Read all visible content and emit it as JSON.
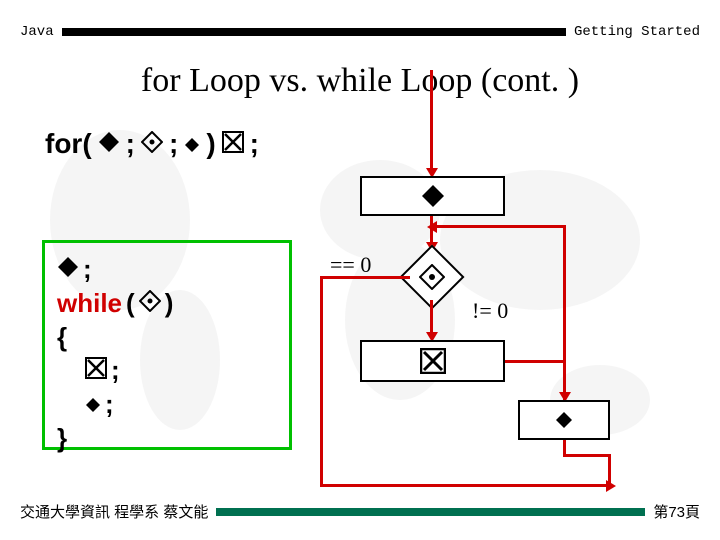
{
  "header": {
    "left": "Java",
    "right": "Getting Started"
  },
  "title": "for Loop vs. while Loop (cont. )",
  "for_line": {
    "kw": "for(",
    "sep1": " ; ",
    "sep2": " ; ",
    "close": ") ",
    "end": ";"
  },
  "while_block": {
    "line1_end": ";",
    "while_kw": "while",
    "while_open": "(",
    "while_close": " )",
    "brace_open": "{",
    "body1_end": " ;",
    "body2_end": ";",
    "brace_close": "}"
  },
  "flow": {
    "eq_label": "== 0",
    "ne_label": "!= 0"
  },
  "symbols": {
    "init": "◆",
    "cond": "❖",
    "update": "◆",
    "body": "⌧",
    "update_small": "◆"
  },
  "footer": {
    "left": "交通大學資訊 程學系 蔡文能",
    "right": "第73頁"
  }
}
